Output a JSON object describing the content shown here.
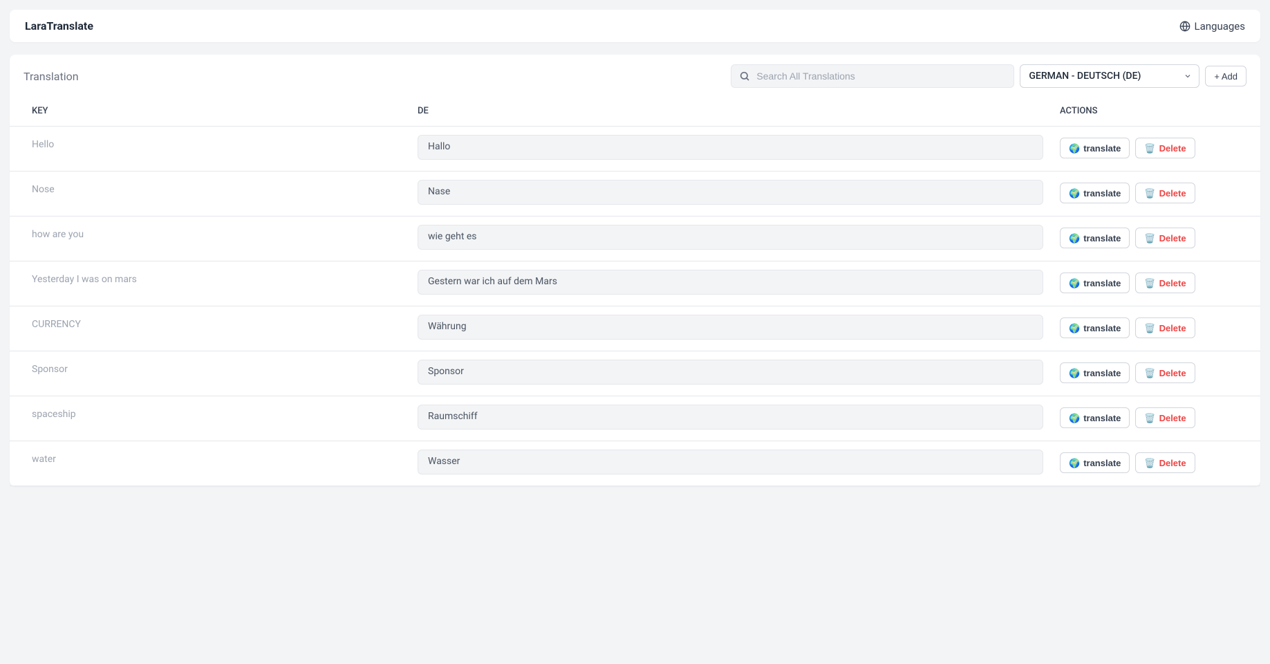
{
  "header": {
    "brand": "LaraTranslate",
    "languages_label": "Languages"
  },
  "main": {
    "title": "Translation",
    "search_placeholder": "Search All Translations",
    "selected_language": "GERMAN - DEUTSCH (DE)",
    "add_button": "+ Add",
    "columns": {
      "key": "KEY",
      "de": "DE",
      "actions": "ACTIONS"
    },
    "translate_label": "translate",
    "delete_label": "Delete",
    "rows": [
      {
        "key": "Hello",
        "de": "Hallo"
      },
      {
        "key": "Nose",
        "de": "Nase"
      },
      {
        "key": "how are you",
        "de": "wie geht es"
      },
      {
        "key": "Yesterday I was on mars",
        "de": "Gestern war ich auf dem Mars"
      },
      {
        "key": "CURRENCY",
        "de": "Währung"
      },
      {
        "key": "Sponsor",
        "de": "Sponsor"
      },
      {
        "key": "spaceship",
        "de": "Raumschiff"
      },
      {
        "key": "water",
        "de": "Wasser"
      }
    ]
  }
}
